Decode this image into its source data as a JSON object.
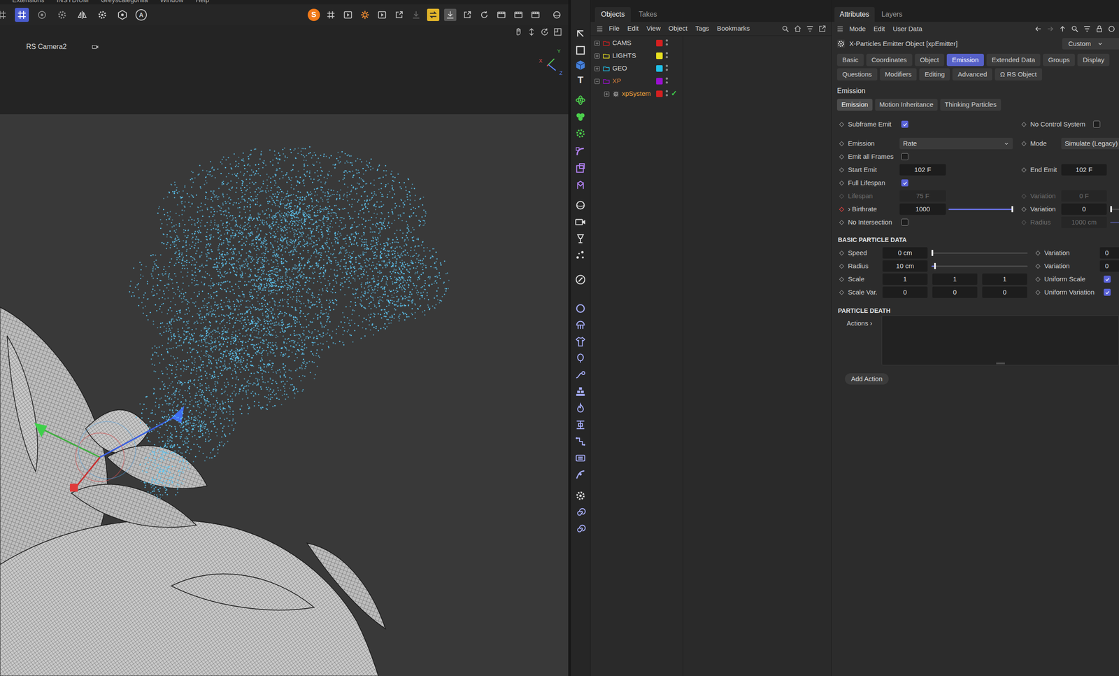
{
  "menubar": [
    "Extensions",
    "INSYDIUM",
    "Greyscalegorilla",
    "Window",
    "Help"
  ],
  "toolbar": {
    "auto_key": "A",
    "render_logo": "S"
  },
  "viewport": {
    "camera": "RS Camera2",
    "axes": [
      {
        "label": "X",
        "color": "#e05050"
      },
      {
        "label": "Y",
        "color": "#50c050"
      },
      {
        "label": "Z",
        "color": "#5a86ff"
      }
    ]
  },
  "tool_strip": {
    "text_tool": "T"
  },
  "objects": {
    "tabs": [
      {
        "label": "Objects",
        "selected": true
      },
      {
        "label": "Takes",
        "selected": false
      }
    ],
    "menu": [
      "File",
      "Edit",
      "View",
      "Object",
      "Tags",
      "Bookmarks"
    ],
    "tree": [
      {
        "name": "CAMS",
        "depth": 0,
        "kind": "layer",
        "expanded": false,
        "selected": false,
        "in_selection_path": false,
        "color": "#d42020"
      },
      {
        "name": "LIGHTS",
        "depth": 0,
        "kind": "layer",
        "expanded": false,
        "selected": false,
        "in_selection_path": false,
        "color": "#e8e020"
      },
      {
        "name": "GEO",
        "depth": 0,
        "kind": "layer",
        "expanded": false,
        "selected": false,
        "in_selection_path": false,
        "color": "#20c0e8"
      },
      {
        "name": "XP",
        "depth": 0,
        "kind": "layer",
        "expanded": true,
        "selected": false,
        "in_selection_path": true,
        "color": "#9a10d0"
      },
      {
        "name": "xpSystem",
        "depth": 1,
        "kind": "system",
        "expanded": false,
        "selected": true,
        "in_selection_path": true,
        "color": "#d42020",
        "status": "✓"
      }
    ]
  },
  "attributes": {
    "tabs": [
      {
        "label": "Attributes",
        "selected": true
      },
      {
        "label": "Layers",
        "selected": false
      }
    ],
    "menu": [
      "Mode",
      "Edit",
      "User Data"
    ],
    "object_title": "X-Particles Emitter Object [xpEmitter]",
    "preset": "Custom",
    "tab_rows": [
      [
        {
          "label": "Basic",
          "selected": false
        },
        {
          "label": "Coordinates",
          "selected": false
        },
        {
          "label": "Object",
          "selected": false
        },
        {
          "label": "Emission",
          "selected": true
        },
        {
          "label": "Extended Data",
          "selected": false
        },
        {
          "label": "Groups",
          "selected": false
        },
        {
          "label": "Display",
          "selected": false
        }
      ],
      [
        {
          "label": "Questions",
          "selected": false
        },
        {
          "label": "Modifiers",
          "selected": false
        },
        {
          "label": "Editing",
          "selected": false
        },
        {
          "label": "Advanced",
          "selected": false
        },
        {
          "label": "Ω RS Object",
          "selected": false
        }
      ]
    ],
    "section": "Emission",
    "subtabs": [
      {
        "label": "Emission",
        "selected": true
      },
      {
        "label": "Motion Inheritance",
        "selected": false
      },
      {
        "label": "Thinking Particles",
        "selected": false
      }
    ],
    "emission_rows": [
      {
        "left": {
          "kind": "check",
          "label": "Subframe Emit",
          "checked": true,
          "animated": false,
          "disabled": false
        },
        "right": {
          "kind": "check",
          "label": "No Control System",
          "checked": false,
          "animated": false,
          "disabled": false
        }
      },
      {
        "left": {
          "kind": "dropdown",
          "label": "Emission",
          "value": "Rate",
          "animated": false,
          "disabled": false
        },
        "right": {
          "kind": "dropdown",
          "label": "Mode",
          "value": "Simulate (Legacy)",
          "animated": false,
          "disabled": false
        }
      },
      {
        "left": {
          "kind": "check",
          "label": "Emit all Frames",
          "checked": false,
          "animated": false,
          "disabled": false
        },
        "right": null
      },
      {
        "left": {
          "kind": "number",
          "label": "Start Emit",
          "value": "102 F",
          "animated": false,
          "disabled": false
        },
        "right": {
          "kind": "number",
          "label": "End Emit",
          "value": "102 F",
          "animated": false,
          "disabled": false
        }
      },
      {
        "left": {
          "kind": "check",
          "label": "Full Lifespan",
          "checked": true,
          "animated": false,
          "disabled": false
        },
        "right": null
      },
      {
        "left": {
          "kind": "number",
          "label": "Lifespan",
          "value": "75 F",
          "animated": false,
          "disabled": true
        },
        "right": {
          "kind": "number",
          "label": "Variation",
          "value": "0 F",
          "animated": false,
          "disabled": true
        }
      },
      {
        "left": {
          "kind": "slider",
          "label": "Birthrate",
          "arrow": "›",
          "value": "1000",
          "level": 1,
          "animated": true,
          "disabled": false
        },
        "right": {
          "kind": "slider",
          "label": "Variation",
          "value": "0",
          "level": 0,
          "animated": false,
          "disabled": false
        }
      },
      {
        "left": {
          "kind": "check",
          "label": "No Intersection",
          "checked": false,
          "animated": false,
          "disabled": false
        },
        "right": {
          "kind": "slider",
          "label": "Radius",
          "value": "1000 cm",
          "level": 1,
          "animated": false,
          "disabled": true
        }
      }
    ],
    "basic_heading": "BASIC PARTICLE DATA",
    "basic_rows": [
      {
        "left": {
          "kind": "slider",
          "label": "Speed",
          "value": "0 cm",
          "level": 0,
          "animated": false,
          "disabled": false
        },
        "right": {
          "kind": "number",
          "label": "Variation",
          "value": "0",
          "animated": false,
          "disabled": false
        }
      },
      {
        "left": {
          "kind": "slider",
          "label": "Radius",
          "value": "10 cm",
          "level": 0.03,
          "animated": false,
          "disabled": false
        },
        "right": {
          "kind": "number",
          "label": "Variation",
          "value": "0",
          "animated": false,
          "disabled": false
        }
      },
      {
        "left": {
          "kind": "vector",
          "label": "Scale",
          "values": [
            "1",
            "1",
            "1"
          ],
          "animated": false,
          "disabled": false
        },
        "right": {
          "kind": "check",
          "label": "Uniform Scale",
          "checked": true,
          "animated": false,
          "disabled": false
        }
      },
      {
        "left": {
          "kind": "vector",
          "label": "Scale Var.",
          "values": [
            "0",
            "0",
            "0"
          ],
          "animated": false,
          "disabled": false
        },
        "right": {
          "kind": "check",
          "label": "Uniform Variation",
          "checked": true,
          "animated": false,
          "disabled": false
        }
      }
    ],
    "death_heading": "PARTICLE DEATH",
    "actions": {
      "label": "Actions",
      "arrow": "›"
    },
    "add_button": "Add Action"
  }
}
